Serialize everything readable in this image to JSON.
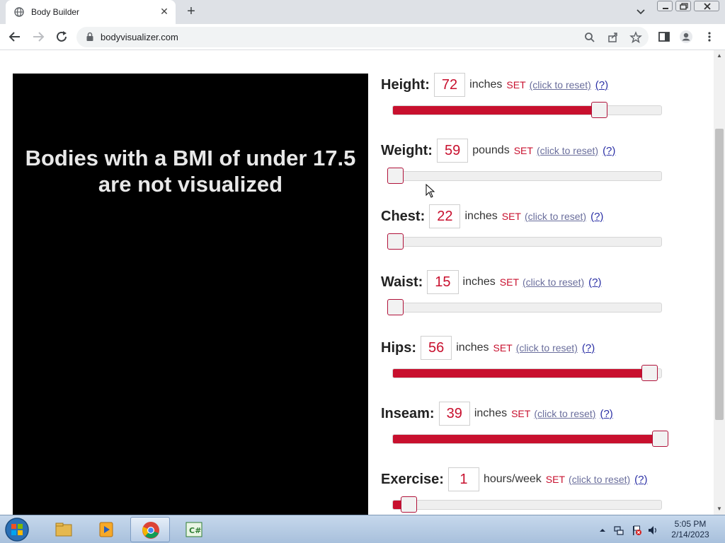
{
  "browser": {
    "tab_title": "Body Builder",
    "url": "bodyvisualizer.com"
  },
  "visual": {
    "message": "Bodies with a BMI of under 17.5 are not visualized"
  },
  "controls": [
    {
      "label": "Height:",
      "value": "72",
      "unit": "inches",
      "set": "SET",
      "reset": "(click to reset)",
      "help": "(?)",
      "level": 0.77
    },
    {
      "label": "Weight:",
      "value": "59",
      "unit": "pounds",
      "set": "SET",
      "reset": "(click to reset)",
      "help": "(?)",
      "level": 0.0
    },
    {
      "label": "Chest:",
      "value": "22",
      "unit": "inches",
      "set": "SET",
      "reset": "(click to reset)",
      "help": "(?)",
      "level": 0.0
    },
    {
      "label": "Waist:",
      "value": "15",
      "unit": "inches",
      "set": "SET",
      "reset": "(click to reset)",
      "help": "(?)",
      "level": 0.0
    },
    {
      "label": "Hips:",
      "value": "56",
      "unit": "inches",
      "set": "SET",
      "reset": "(click to reset)",
      "help": "(?)",
      "level": 0.96
    },
    {
      "label": "Inseam:",
      "value": "39",
      "unit": "inches",
      "set": "SET",
      "reset": "(click to reset)",
      "help": "(?)",
      "level": 1.0
    },
    {
      "label": "Exercise:",
      "value": "1",
      "unit": "hours/week",
      "set": "SET",
      "reset": "(click to reset)",
      "help": "(?)",
      "level": 0.05
    }
  ],
  "colors": {
    "accent": "#c8102e",
    "panel": "#000000",
    "reset_link": "#6a6e9c",
    "help_link": "#2a2fa5"
  },
  "taskbar": {
    "time": "5:05 PM",
    "date": "2/14/2023",
    "items": [
      "start-orb-icon",
      "file-explorer-icon",
      "media-player-icon",
      "chrome-icon",
      "csharp-app-icon"
    ]
  }
}
